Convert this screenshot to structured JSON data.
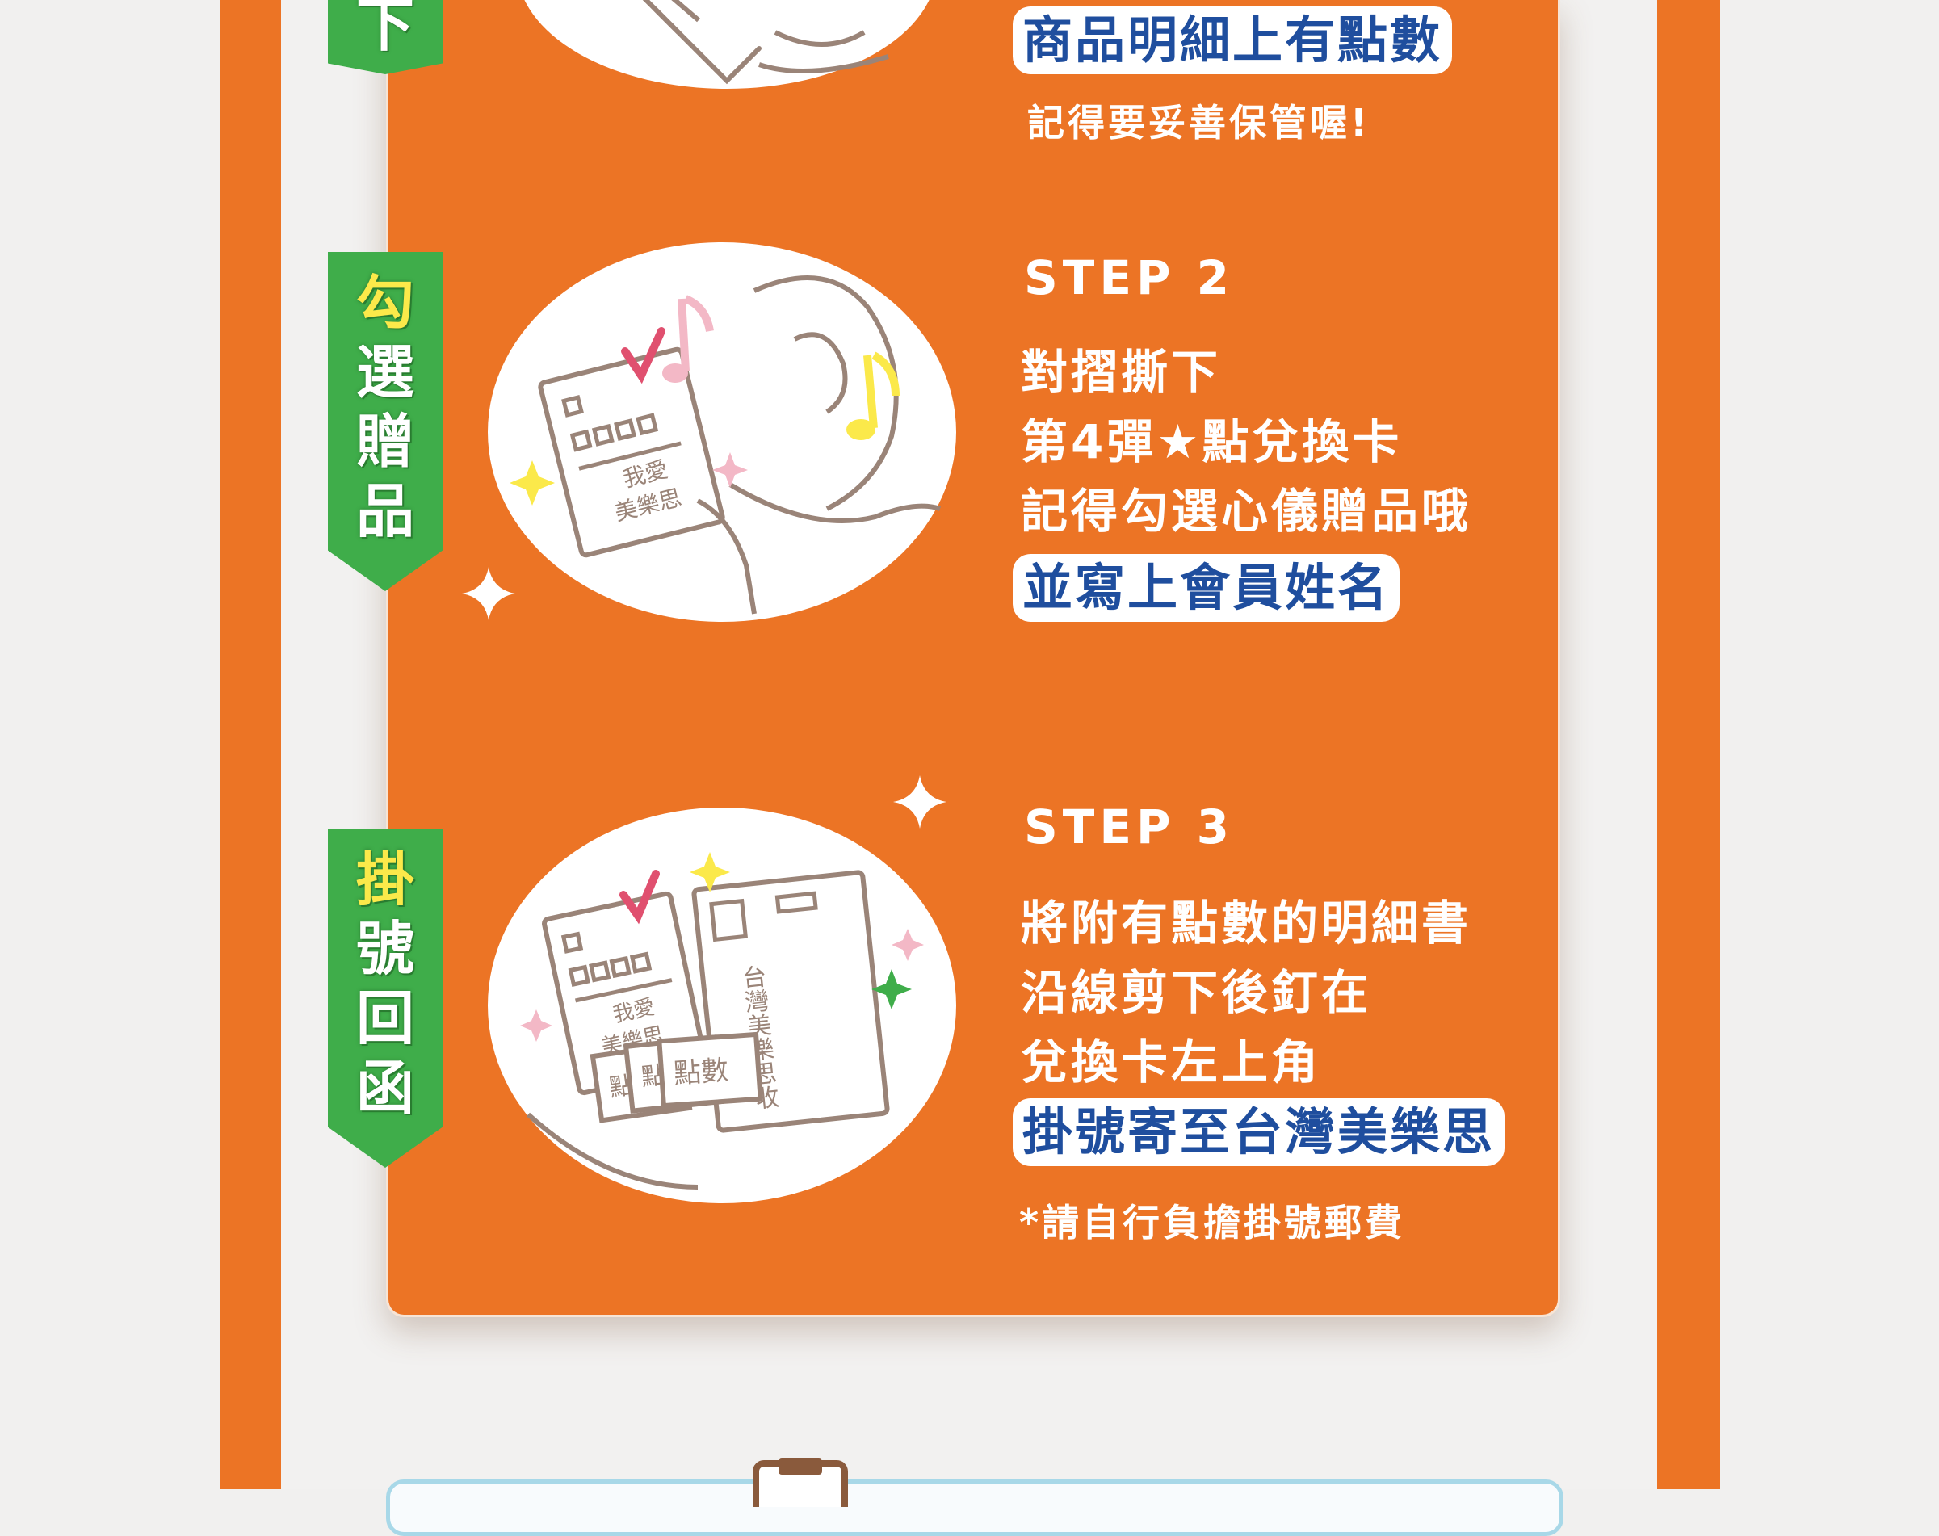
{
  "tabs": {
    "top": {
      "chars": [
        "下"
      ]
    },
    "step2": {
      "chars": [
        "勾",
        "選",
        "贈",
        "品"
      ]
    },
    "step3": {
      "chars": [
        "掛",
        "號",
        "回",
        "函"
      ]
    }
  },
  "step1": {
    "highlight": "商品明細上有點數",
    "note": "記得要妥善保管喔!"
  },
  "step2": {
    "title": "STEP 2",
    "lines": [
      "對摺撕下",
      "第4彈★點兌換卡",
      "記得勾選心儀贈品哦"
    ],
    "highlight": "並寫上會員姓名",
    "illustration": {
      "card_text_1": "我愛",
      "card_text_2": "美樂思"
    }
  },
  "step3": {
    "title": "STEP 3",
    "lines": [
      "將附有點數的明細書",
      "沿線剪下後釘在",
      "兌換卡左上角"
    ],
    "highlight": "掛號寄至台灣美樂思",
    "note": "*請自行負擔掛號郵費",
    "illustration": {
      "card_text_1": "我愛",
      "card_text_2": "美樂思",
      "coupon_text": "點數",
      "coupon_back_1": "點",
      "coupon_back_2": "點",
      "envelope_text": "台灣美樂思收"
    }
  },
  "colors": {
    "orange": "#ec7425",
    "green": "#3fad4a",
    "yellow": "#fbe94a",
    "blue_text": "#1f4e9e",
    "sketch": "#9a8478",
    "check": "#e0506f"
  }
}
